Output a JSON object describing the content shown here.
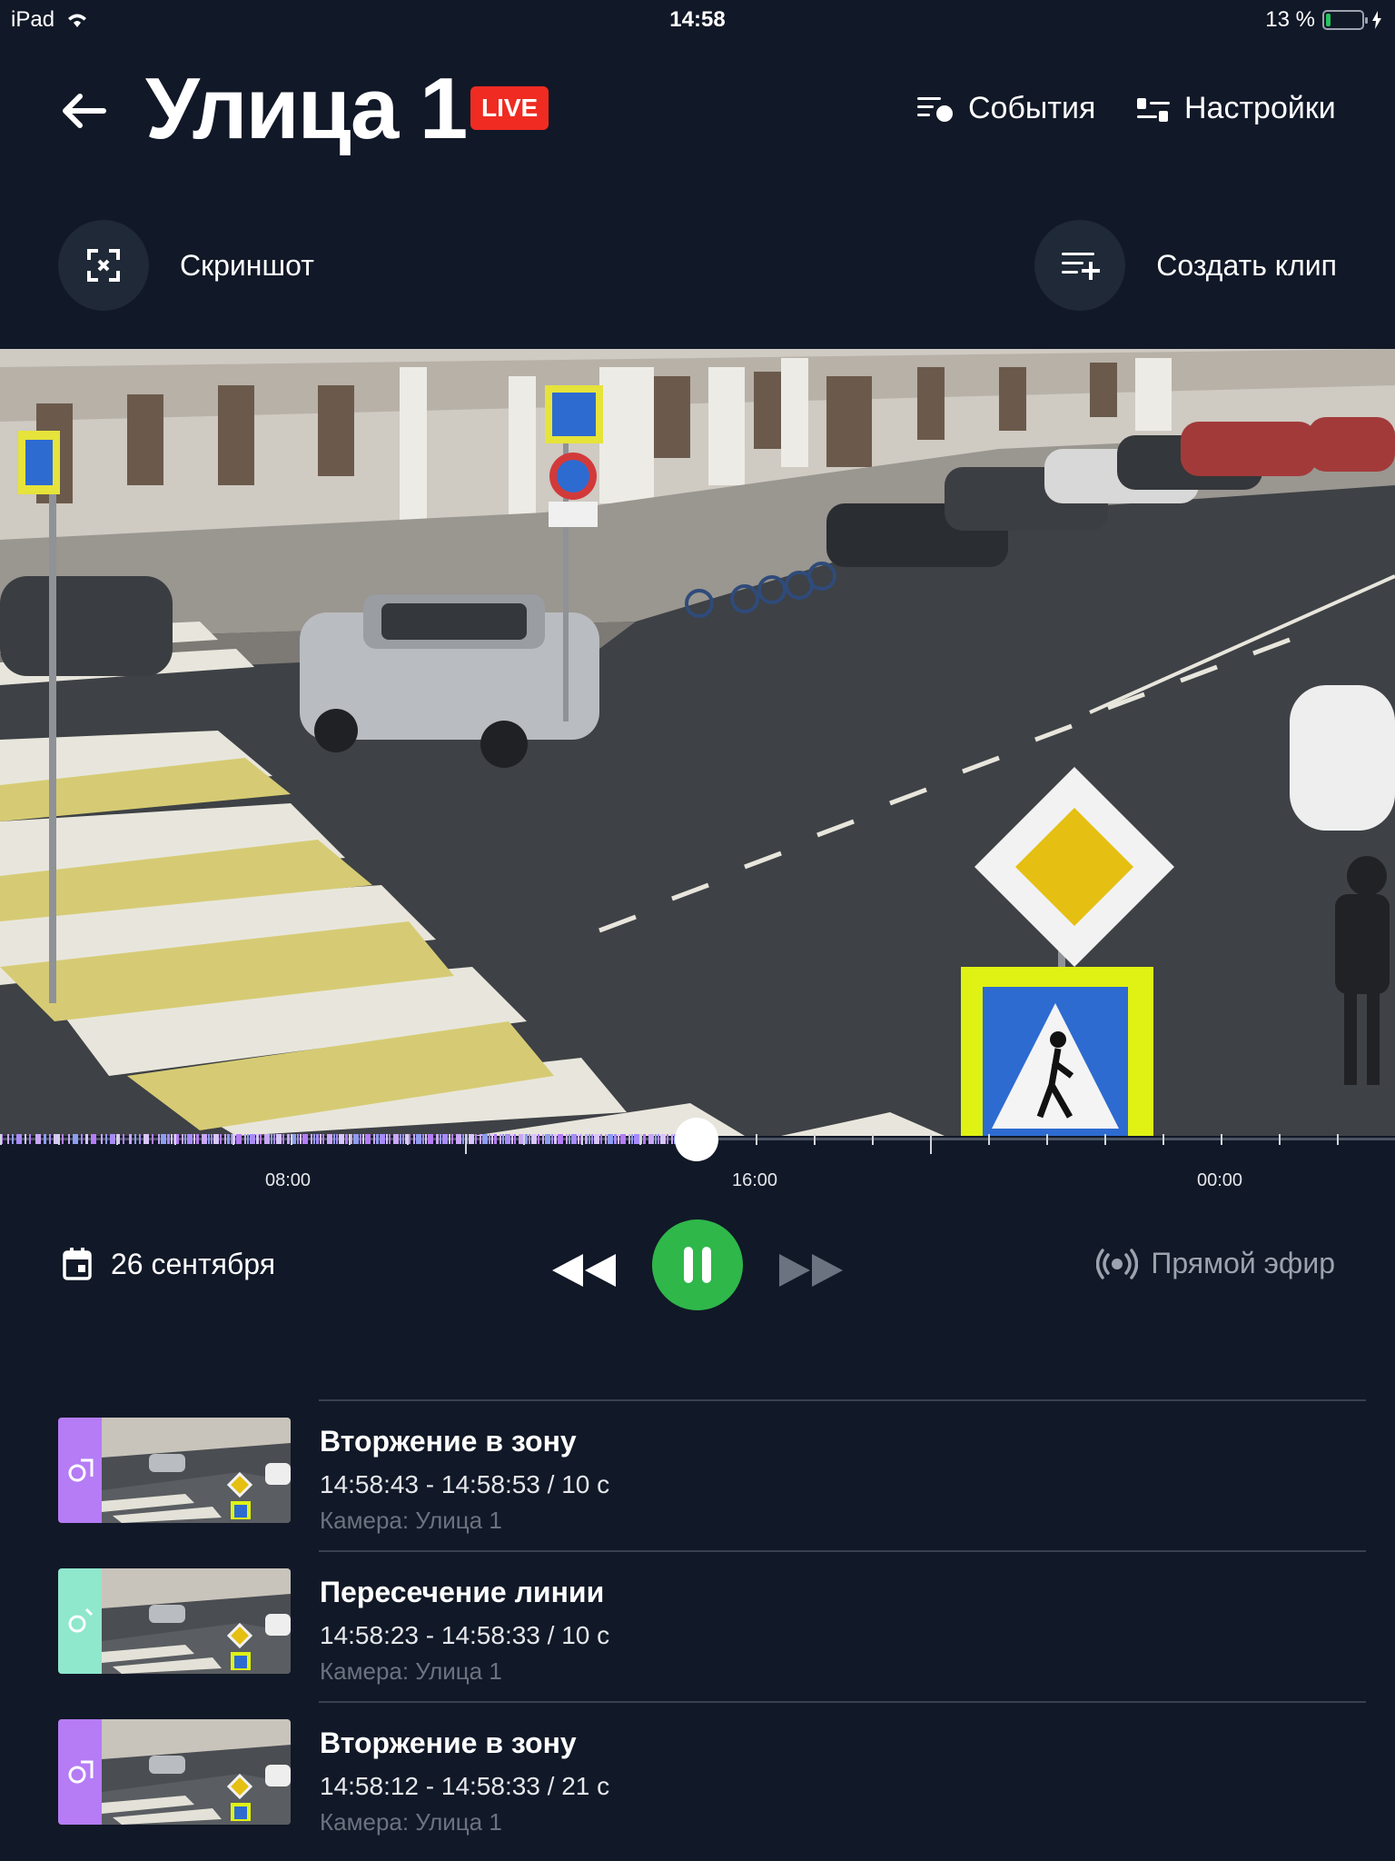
{
  "status_bar": {
    "device": "iPad",
    "time": "14:58",
    "battery": "13 %",
    "battery_level": 0.13
  },
  "header": {
    "title": "Улица 1",
    "live_badge": "LIVE",
    "events_label": "События",
    "settings_label": "Настройки"
  },
  "actions": {
    "screenshot_label": "Скриншот",
    "clip_label": "Создать клип"
  },
  "timeline": {
    "labels": [
      "08:00",
      "16:00",
      "00:00"
    ],
    "playhead_fraction": 0.5
  },
  "controls": {
    "date": "26 сентября",
    "live_label": "Прямой эфир",
    "accent": "#2fb74a"
  },
  "events": [
    {
      "title": "Вторжение в зону",
      "time": "14:58:43 - 14:58:53 / 10 с",
      "camera": "Камера: Улица 1",
      "color": "#b57cf5",
      "icon": "zone-icon"
    },
    {
      "title": "Пересечение линии",
      "time": "14:58:23 - 14:58:33 / 10 с",
      "camera": "Камера: Улица 1",
      "color": "#8fe7cc",
      "icon": "line-cross-icon"
    },
    {
      "title": "Вторжение в зону",
      "time": "14:58:12 - 14:58:33 / 21 с",
      "camera": "Камера: Улица 1",
      "color": "#b57cf5",
      "icon": "zone-icon"
    }
  ]
}
